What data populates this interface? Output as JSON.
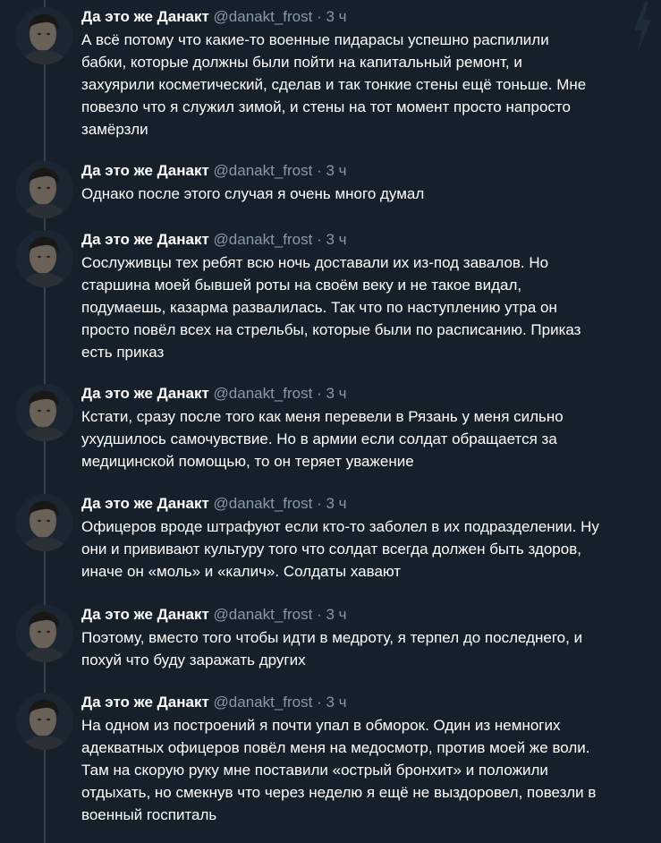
{
  "author": {
    "name": "Да это же Данакт",
    "handle": "@danakt_frost",
    "separator": "·"
  },
  "tweets": [
    {
      "time": "3 ч",
      "text": "А всё потому что какие-то военные пидарасы успешно распилили\nбабки, которые должны были пойти на капитальный ремонт, и\nзахуярили косметический, сделав и так тонкие стены ещё тоньше. Мне\nповезло что я служил зимой, и стены на тот момент просто напросто\nзамёрзли"
    },
    {
      "time": "3 ч",
      "text": "Однако после этого случая я очень много думал"
    },
    {
      "time": "3 ч",
      "text": "Сослуживцы тех ребят всю ночь доставали их из-под завалов. Но\nстаршина моей бывшей роты на своём веку и не такое видал,\nподумаешь, казарма развалилась. Так что по наступлению утра он\nпросто повёл всех на стрельбы, которые были по расписанию. Приказ\nесть приказ"
    },
    {
      "time": "3 ч",
      "text": "Кстати, сразу после того как меня перевели в Рязань у меня сильно\nухудшилось самочувствие. Но в армии если солдат обращается за\nмедицинской помощью, то он теряет уважение"
    },
    {
      "time": "3 ч",
      "text": "Офицеров вроде штрафуют если кто-то заболел в их подразделении. Ну\nони и прививают культуру того что солдат всегда должен быть здоров,\nиначе он «моль» и «калич». Солдаты хавают"
    },
    {
      "time": "3 ч",
      "text": "Поэтому, вместо того чтобы идти в медроту, я терпел до последнего, и\nпохуй что буду заражать других"
    },
    {
      "time": "3 ч",
      "text": "На одном из построений я почти упал в обморок. Один из немногих\nадекватных офицеров повёл меня на медосмотр, против моей же воли.\nТам на скорую руку мне поставили «острый бронхит» и положили\nотдыхать, но смекнув что через неделю я ещё не выздоровел, повезли в\nвоенный госпиталь"
    }
  ],
  "icons": {
    "corner": "lightning-bolt-icon"
  },
  "colors": {
    "background": "#15202b",
    "text": "#ffffff",
    "secondary": "#8899a6",
    "thread_line": "#38444d"
  }
}
